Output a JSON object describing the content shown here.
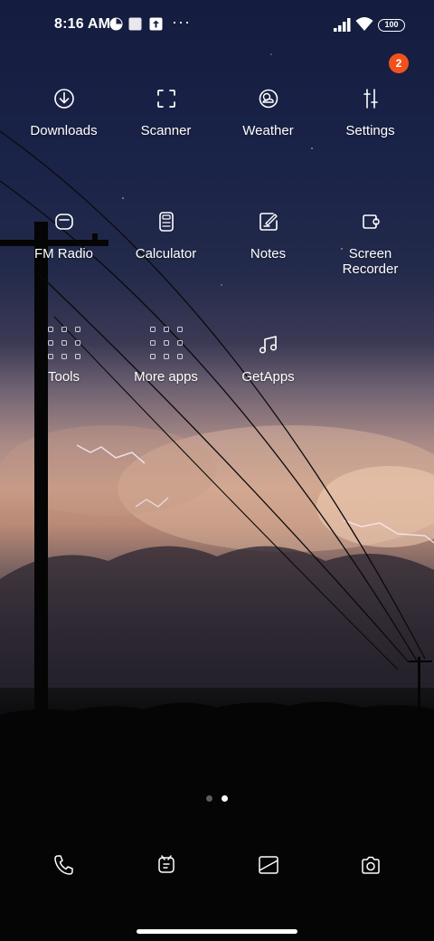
{
  "status_bar": {
    "time": "8:16 AM",
    "overflow": "···",
    "battery": "100",
    "icons": [
      "pie-chart-icon",
      "square-icon",
      "upload-icon",
      "signal-icon",
      "wifi-icon",
      "battery-icon"
    ]
  },
  "apps": [
    {
      "label": "Downloads",
      "icon": "download-icon"
    },
    {
      "label": "Scanner",
      "icon": "scan-icon"
    },
    {
      "label": "Weather",
      "icon": "weather-icon"
    },
    {
      "label": "Settings",
      "icon": "settings-sliders-icon",
      "badge": "2"
    },
    {
      "label": "FM Radio",
      "icon": "radio-icon"
    },
    {
      "label": "Calculator",
      "icon": "calculator-icon"
    },
    {
      "label": "Notes",
      "icon": "notes-icon"
    },
    {
      "label": "Screen Recorder",
      "icon": "screen-recorder-icon"
    },
    {
      "label": "Tools",
      "icon": "folder-icon"
    },
    {
      "label": "More apps",
      "icon": "folder-icon"
    },
    {
      "label": "GetApps",
      "icon": "music-note-icon"
    }
  ],
  "page_indicator": {
    "pages": 2,
    "active": 2
  },
  "dock": [
    {
      "icon": "phone-icon"
    },
    {
      "icon": "messages-icon"
    },
    {
      "icon": "browser-icon"
    },
    {
      "icon": "camera-icon"
    }
  ]
}
